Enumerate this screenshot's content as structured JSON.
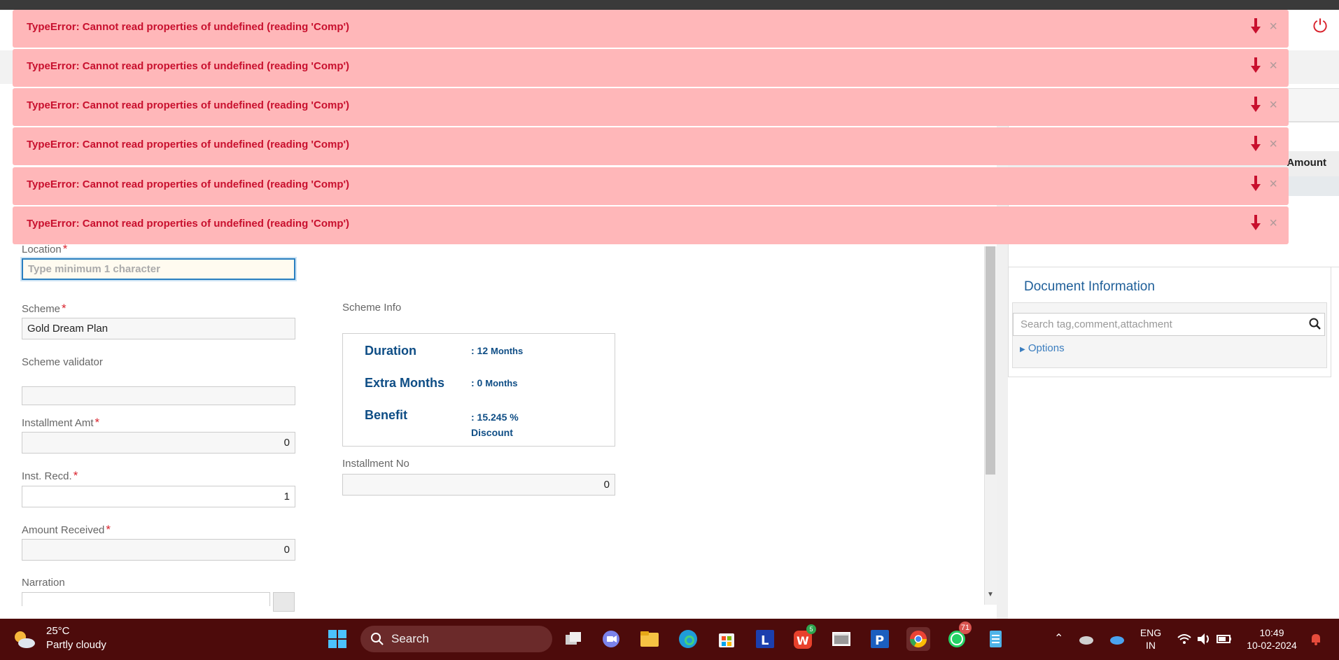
{
  "errors": [
    "TypeError: Cannot read properties of undefined (reading 'Comp')",
    "TypeError: Cannot read properties of undefined (reading 'Comp')",
    "TypeError: Cannot read properties of undefined (reading 'Comp')",
    "TypeError: Cannot read properties of undefined (reading 'Comp')",
    "TypeError: Cannot read properties of undefined (reading 'Comp')",
    "TypeError: Cannot read properties of undefined (reading 'Comp')"
  ],
  "right_panel": {
    "amount_header": "Amount",
    "doc_info_title": "Document Information",
    "search_placeholder": "Search tag,comment,attachment",
    "options_label": "Options"
  },
  "form": {
    "location_label": "Location",
    "location_placeholder": "Type minimum 1 character",
    "scheme_label": "Scheme",
    "scheme_value": "Gold Dream Plan",
    "scheme_validator_label": "Scheme validator",
    "scheme_validator_value": "",
    "installment_amt_label": "Installment Amt",
    "installment_amt_value": "0",
    "inst_recd_label": "Inst. Recd.",
    "inst_recd_value": "1",
    "amount_received_label": "Amount Received",
    "amount_received_value": "0",
    "narration_label": "Narration",
    "scheme_info_label": "Scheme Info",
    "installment_no_label": "Installment No",
    "installment_no_value": "0"
  },
  "scheme_info": {
    "duration_label": "Duration",
    "duration_value": ": 12",
    "duration_unit": "Months",
    "extra_label": "Extra Months",
    "extra_value": ": 0",
    "extra_unit": "Months",
    "benefit_label": "Benefit",
    "benefit_value": ": 15.245 %",
    "benefit_unit": "Discount"
  },
  "taskbar": {
    "temperature": "25°C",
    "weather": "Partly cloudy",
    "search_label": "Search",
    "lang_1": "ENG",
    "lang_2": "IN",
    "time": "10:49",
    "date": "10-02-2024",
    "whatsapp_badge": "71",
    "wps_badge": "5"
  },
  "colors": {
    "error_bg": "#ffb7b9",
    "error_text": "#c8102e",
    "scheme_info_text": "#0e4d85",
    "taskbar_bg": "#4d0b0b"
  }
}
